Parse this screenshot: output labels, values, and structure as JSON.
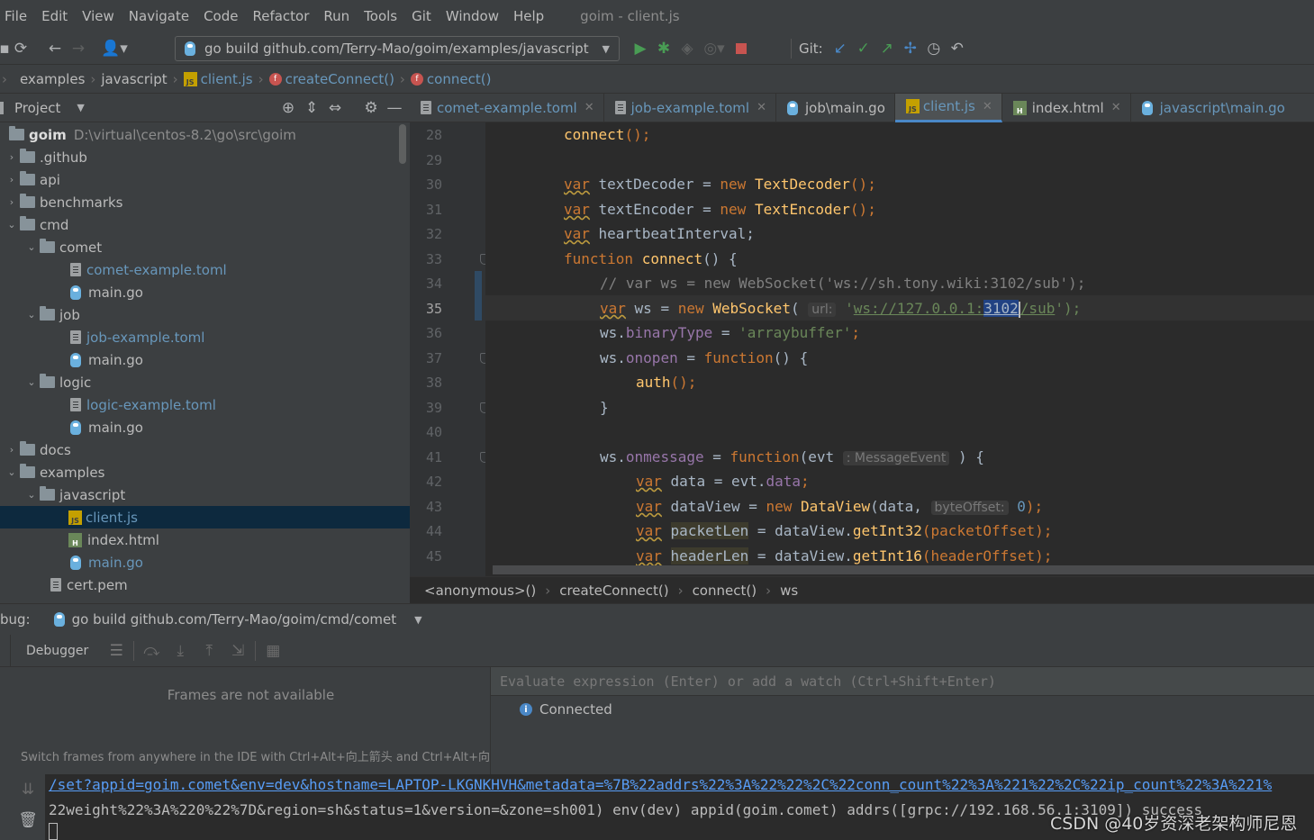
{
  "menu": [
    "File",
    "Edit",
    "View",
    "Navigate",
    "Code",
    "Refactor",
    "Run",
    "Tools",
    "Git",
    "Window",
    "Help"
  ],
  "window_title": "goim - client.js",
  "toolbar": {
    "run_config": "go build github.com/Terry-Mao/goim/examples/javascript",
    "git_label": "Git:"
  },
  "breadcrumb": [
    "examples",
    "javascript",
    "client.js",
    "createConnect()",
    "connect()"
  ],
  "project": {
    "title": "Project",
    "root_name": "goim",
    "root_path": "D:\\virtual\\centos-8.2\\go\\src\\goim",
    "nodes": [
      ".github",
      "api",
      "benchmarks",
      "cmd",
      "comet",
      "comet-example.toml",
      "main.go",
      "job",
      "job-example.toml",
      "main.go",
      "logic",
      "logic-example.toml",
      "main.go",
      "docs",
      "examples",
      "javascript",
      "client.js",
      "index.html",
      "main.go",
      "cert.pem"
    ]
  },
  "tabs": [
    "comet-example.toml",
    "job-example.toml",
    "job\\main.go",
    "client.js",
    "index.html",
    "javascript\\main.go"
  ],
  "editor": {
    "line_numbers": [
      "28",
      "29",
      "30",
      "31",
      "32",
      "33",
      "34",
      "35",
      "36",
      "37",
      "38",
      "39",
      "40",
      "41",
      "42",
      "43",
      "44",
      "45"
    ],
    "current_line": "35",
    "code": {
      "l28_fn": "connect",
      "l28_rest": "();",
      "var": "var",
      "new": "new",
      "function": "function",
      "l30_name": " textDecoder = ",
      "l30_ctor": "TextDecoder",
      "l31_name": " textEncoder = ",
      "l31_ctor": "TextEncoder",
      "l32_name": " heartbeatInterval;",
      "l33_fn": "connect",
      "l33_rest": "() {",
      "l34_comment": "// var ws = new WebSocket('ws://sh.tony.wiki:3102/sub');",
      "l35_name": " ws = ",
      "l35_ctor": "WebSocket",
      "l35_open": "(",
      "l35_hint": "url:",
      "l35_q1": "'",
      "l35_url_a": "ws://127.0.0.1:",
      "l35_url_port": "3102",
      "l35_url_b": "/sub",
      "l35_end": "');",
      "l36_ws": "ws.",
      "l36_prop": "binaryType",
      "l36_eq": " = ",
      "l36_str": "'arraybuffer'",
      "l36_semi": ";",
      "l37_ws": "ws.",
      "l37_prop": "onopen",
      "l37_eq": " = ",
      "l37_rest": "() {",
      "l38_fn": "auth",
      "l38_rest": "();",
      "l39": "}",
      "l41_ws": "ws.",
      "l41_prop": "onmessage",
      "l41_eq": " = ",
      "l41_open": "(evt ",
      "l41_hint": ": MessageEvent",
      "l41_close": " ) {",
      "l42_mid": " data = evt.",
      "l42_prop": "data",
      "l42_semi": ";",
      "l43_mid": " dataView = ",
      "l43_ctor": "DataView",
      "l43_args": "(data, ",
      "l43_hint": "byteOffset:",
      "l43_num": " 0",
      "l43_end": ");",
      "l44_var": "packetLen",
      "l44_mid": " = dataView.",
      "l44_fn": "getInt32",
      "l44_end": "(packetOffset);",
      "l45_var": "headerLen",
      "l45_mid": " = dataView.",
      "l45_fn": "getInt16",
      "l45_end": "(headerOffset);"
    }
  },
  "editor_breadcrumb": [
    "<anonymous>()",
    "createConnect()",
    "connect()",
    "ws"
  ],
  "debug": {
    "label": "bug:",
    "config": "go build github.com/Terry-Mao/goim/cmd/comet",
    "tab": "Debugger",
    "frames_empty": "Frames are not available",
    "frames_hint": "Switch frames from anywhere in the IDE with Ctrl+Alt+向上箭头 and Ctrl+Alt+向",
    "eval_placeholder": "Evaluate expression (Enter) or add a watch (Ctrl+Shift+Enter)",
    "status": "Connected"
  },
  "console": {
    "line1": "/set?appid=goim.comet&env=dev&hostname=LAPTOP-LKGNKHVH&metadata=%7B%22addrs%22%3A%22%22%2C%22conn_count%22%3A%221%22%2C%22ip_count%22%3A%221%",
    "line2": "22weight%22%3A%220%22%7D&region=sh&status=1&version=&zone=sh001) env(dev) appid(goim.comet) addrs([grpc://192.168.56.1:3109]) success"
  },
  "watermark": "CSDN @40岁资深老架构师尼恩",
  "colors": {
    "background": "#2b2b2b",
    "panel": "#3c3f41",
    "keyword": "#cc7832",
    "function": "#ffc66d",
    "string": "#6a8759",
    "property": "#9876aa",
    "link": "#6897bb",
    "run_green": "#499c54",
    "stop_red": "#c75450"
  }
}
